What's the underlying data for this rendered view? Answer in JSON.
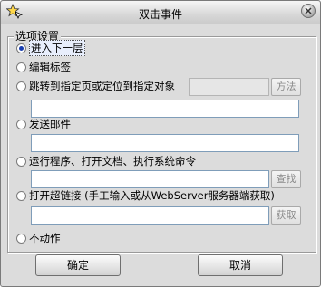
{
  "window": {
    "title": "双击事件",
    "icon": "app-star-icon",
    "close_icon": "close-icon"
  },
  "group": {
    "legend": "选项设置"
  },
  "options": [
    {
      "label": "进入下一层",
      "selected": true
    },
    {
      "label": "编辑标签",
      "selected": false
    },
    {
      "label": "跳转到指定页或定位到指定对象",
      "selected": false
    },
    {
      "label": "发送邮件",
      "selected": false
    },
    {
      "label": "运行程序、打开文档、执行系统命令",
      "selected": false
    },
    {
      "label": "打开超链接  (手工输入或从WebServer服务器端获取)",
      "selected": false
    },
    {
      "label": "不动作",
      "selected": false
    }
  ],
  "buttons": {
    "method": "方法",
    "find": "查找",
    "fetch": "获取",
    "ok": "确定",
    "cancel": "取消"
  },
  "fields": {
    "jump_target": "",
    "jump_object": "",
    "email": "",
    "command": "",
    "url": ""
  }
}
